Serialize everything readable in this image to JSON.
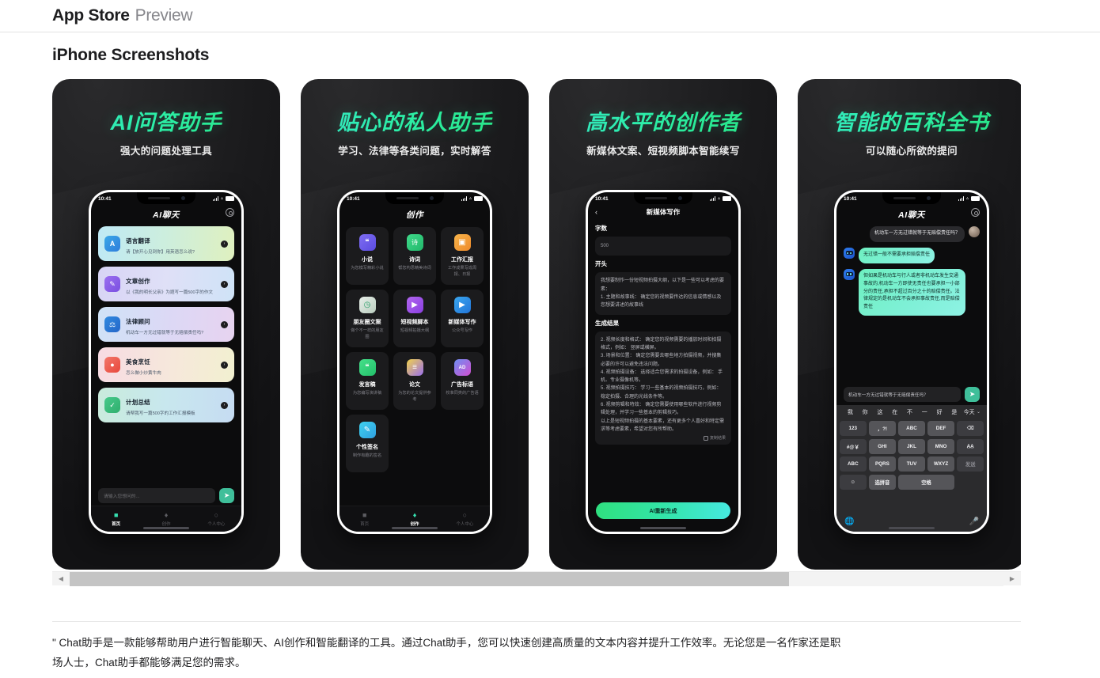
{
  "topbar": {
    "brand": "App Store",
    "preview": "Preview"
  },
  "section_title": "iPhone Screenshots",
  "status": {
    "time": "10:41",
    "wifi": "▾",
    "icons": [
      "signal-icon",
      "wifi-icon",
      "battery-icon"
    ]
  },
  "scroll": {
    "left_arrow": "◀",
    "right_arrow": "▶"
  },
  "description": "\" Chat助手是一款能够帮助用户进行智能聊天、AI创作和智能翻译的工具。通过Chat助手，您可以快速创建高质量的文本内容并提升工作效率。无论您是一名作家还是职场人士，Chat助手都能够满足您的需求。",
  "shots": [
    {
      "headline": "AI问答助手",
      "subhead": "强大的问题处理工具",
      "app_title": "AI聊天",
      "cards": [
        {
          "name": "语言翻译",
          "desc": "请【放开心见到你】用英语怎么说?",
          "icon": "translate-icon",
          "glyph": "A",
          "bg": "linear-gradient(95deg,#bfe9f5 0%,#cdeedd 50%,#dff0bf 100%)",
          "ibg": "linear-gradient(135deg,#3aa7e8,#2f7ddb)"
        },
        {
          "name": "文章创作",
          "desc": "以《我的明长父亲》为题写一篇500字的作文",
          "icon": "pencil-icon",
          "glyph": "✎",
          "bg": "linear-gradient(95deg,#d8d4f5 0%,#dfe0f7 50%,#cfe3f7 100%)",
          "ibg": "linear-gradient(135deg,#9b6ff0,#7a4fe0)"
        },
        {
          "name": "法律顾问",
          "desc": "机动车一方无过错就等于无赔偿责任吗?",
          "icon": "law-icon",
          "glyph": "⚖",
          "bg": "linear-gradient(95deg,#cfe2f7 0%,#ddd8f5 55%,#e7d3f0 100%)",
          "ibg": "linear-gradient(135deg,#2f8ae0,#2566c8)"
        },
        {
          "name": "美食烹饪",
          "desc": "怎么做小炒黄牛肉",
          "icon": "food-icon",
          "glyph": "●",
          "bg": "linear-gradient(95deg,#f7dbe3 0%,#f6e8db 55%,#f2f0d0 100%)",
          "ibg": "linear-gradient(135deg,#f2766a,#e8483c)"
        },
        {
          "name": "计划总结",
          "desc": "请帮我写一篇500字的工作汇报模板",
          "icon": "plan-icon",
          "glyph": "✓",
          "bg": "linear-gradient(95deg,#c9ebdc 0%,#c8e7ee 50%,#c6dcf2 100%)",
          "ibg": "linear-gradient(135deg,#46c98a,#2fae6d)"
        }
      ],
      "input_placeholder": "请输入您想问的...",
      "send_icon": "send-icon",
      "tabs": [
        {
          "label": "首页",
          "icon": "home-icon",
          "glyph": "■",
          "active": true
        },
        {
          "label": "创作",
          "icon": "create-icon",
          "glyph": "♦",
          "active": false
        },
        {
          "label": "个人中心",
          "icon": "profile-icon",
          "glyph": "○",
          "active": false
        }
      ]
    },
    {
      "headline": "贴心的私人助手",
      "subhead": "学习、法律等各类问题，实时解答",
      "app_title": "创作",
      "grid": [
        {
          "name": "小说",
          "desc": "为您模写精彩小说",
          "icon": "novel-icon",
          "glyph": "❝",
          "ibg": "linear-gradient(135deg,#7f6ef2,#5a4be0)"
        },
        {
          "name": "诗词",
          "desc": "帮您构思精美诗词",
          "icon": "poem-icon",
          "glyph": "诗",
          "ibg": "linear-gradient(135deg,#3fd98a,#22b86b)"
        },
        {
          "name": "工作汇报",
          "desc": "工作成果写成周报、日报",
          "icon": "report-icon",
          "glyph": "▣",
          "ibg": "linear-gradient(135deg,#f7b44a,#ef8a2a)"
        },
        {
          "name": "朋友圈文案",
          "desc": "做个不一样的朋友圈",
          "icon": "moments-icon",
          "glyph": "◷",
          "ibg": "linear-gradient(135deg,#e8efe9,#b9ccbe)"
        },
        {
          "name": "短视频脚本",
          "desc": "短视频拍摄大纲",
          "icon": "video-script-icon",
          "glyph": "▶",
          "ibg": "linear-gradient(135deg,#b266f0,#8a3fe0)"
        },
        {
          "name": "新媒体写作",
          "desc": "公众号写作",
          "icon": "media-write-icon",
          "glyph": "▶",
          "ibg": "linear-gradient(135deg,#3aa7f0,#2274d8)"
        },
        {
          "name": "发言稿",
          "desc": "为您编写演讲稿",
          "icon": "speech-icon",
          "glyph": "❝",
          "ibg": "linear-gradient(135deg,#46e08a,#22c06a)"
        },
        {
          "name": "论文",
          "desc": "为您的论文提供参考",
          "icon": "thesis-icon",
          "glyph": "≡",
          "ibg": "linear-gradient(135deg,#f0d24a,#9b6ff0)"
        },
        {
          "name": "广告标语",
          "desc": "校准同类的广告语",
          "icon": "ad-icon",
          "glyph": "AD",
          "ibg": "linear-gradient(135deg,#6f8ef2,#d04fd0)"
        },
        {
          "name": "个性签名",
          "desc": "制作有趣的签名",
          "icon": "signature-icon",
          "glyph": "✎",
          "ibg": "linear-gradient(135deg,#3fd2f0,#2f9fe0)"
        }
      ],
      "tabs": [
        {
          "label": "首页",
          "icon": "home-icon",
          "glyph": "■",
          "active": false
        },
        {
          "label": "创作",
          "icon": "create-icon",
          "glyph": "♦",
          "active": true
        },
        {
          "label": "个人中心",
          "icon": "profile-icon",
          "glyph": "○",
          "active": false
        }
      ]
    },
    {
      "headline": "高水平的创作者",
      "subhead": "新媒体文案、短视频脚本智能续写",
      "nav_title": "新媒体写作",
      "back_icon": "back-chevron-icon",
      "fields": [
        {
          "label": "字数",
          "value": "500"
        },
        {
          "label": "开头",
          "value": "我想要制作一份短视频拍摄大纲，以下是一些可以考虑的要素：\n1. 主题和故事线： 确定您的视频要传达的信息或情感以及您想要讲述的故事线"
        },
        {
          "label": "生成结果",
          "value": "2. 视频长度和格式： 确定您的视频需要的播放时间和拍摄格式，例如： 竖屏或横屏。\n3. 场景和位置： 确定您需要去哪些地方拍摄视频，并搜集必要的许可以避免违法问题。\n4. 视频拍摄设备： 选择适合您需求的拍摄设备，例如： 手机、专业摄像机等。\n5. 视频拍摄技巧： 学习一些基本的视频拍摄技巧，例如： 稳定拍摄、合理的光线条件等。\n6. 视频剪辑和特效： 确定您需要使用哪些软件进行视频剪辑处理，并学习一些基本的剪辑技巧。\n以上是短视频拍摄的基本要素，还有更多个人喜好和特定需求等考虑要素，希望对您有所帮助。"
        }
      ],
      "copy_label": "复制结果",
      "copy_icon": "copy-icon",
      "regen_label": "AI重新生成"
    },
    {
      "headline": "智能的百科全书",
      "subhead": "可以随心所欲的提问",
      "app_title": "AI聊天",
      "messages": [
        {
          "from": "me",
          "text": "机动车一方无过错就等于无赔偿责任吗？"
        },
        {
          "from": "ai",
          "text": "无过错一般不需要承担赔偿责任"
        },
        {
          "from": "ai",
          "text": "但如果是机动车与行人或者非机动车发生交通事故的,机动车一方即使无责任也要承担一小部分的责任,承担不超过百分之十的赔偿责任。法律规定的是机动车不会承担事故责任,而是赔偿责任"
        }
      ],
      "input_value": "机动车一方无过错就等于无赔偿责任吗？",
      "send_icon": "send-icon",
      "keyboard": {
        "predictions": [
          "我",
          "你",
          "这",
          "在",
          "不",
          "一",
          "好",
          "是",
          "今天"
        ],
        "expand_icon": "chevron-down-icon",
        "rows": [
          [
            "123",
            "，?!",
            "ABC",
            "DEF",
            "⌫"
          ],
          [
            "#@￥",
            "GHI",
            "JKL",
            "MNO",
            "A̲A̲"
          ],
          [
            "ABC",
            "PQRS",
            "TUV",
            "WXYZ",
            "发送"
          ],
          [
            "☺",
            "选拼音",
            "空格"
          ]
        ],
        "globe_icon": "globe-icon",
        "mic_icon": "mic-icon"
      }
    }
  ]
}
